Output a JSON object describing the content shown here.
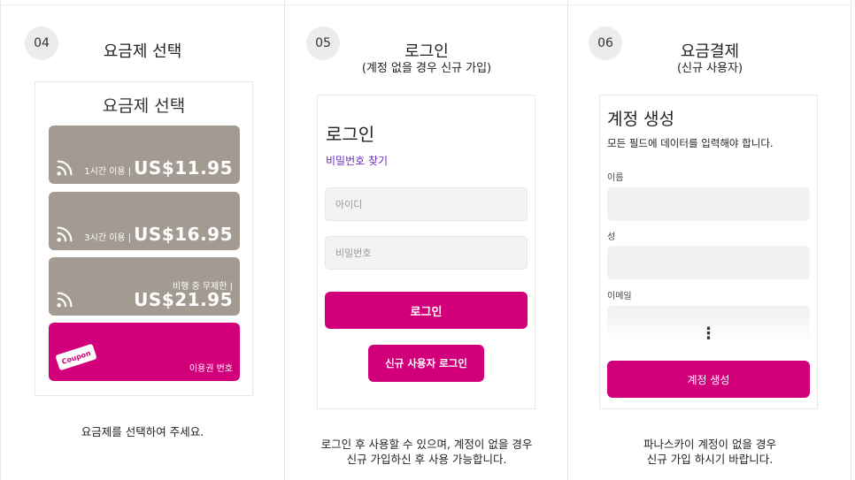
{
  "steps": [
    {
      "number": "04",
      "title": "요금제 선택",
      "caption": "요금제를 선택하여 주세요.",
      "screen": {
        "heading": "요금제 선택",
        "plans": [
          {
            "label": "1시간 이용 |",
            "price": "US$11.95",
            "icon": "wifi-icon"
          },
          {
            "label": "3시간 이용 |",
            "price": "US$16.95",
            "icon": "wifi-icon"
          },
          {
            "label": "비행 중 무제한 |",
            "price": "US$21.95",
            "icon": "wifi-icon"
          }
        ],
        "coupon": {
          "tag": "Coupon",
          "label": "이용권 번호"
        }
      }
    },
    {
      "number": "05",
      "title": "로그인",
      "subtitle": "(계정 없을 경우 신규 가입)",
      "caption_line1": "로그인 후 사용할 수 있으며, 계정이 없을 경우",
      "caption_line2": "신규 가입하신 후 사용 가능합니다.",
      "screen": {
        "heading": "로그인",
        "find_password": "비밀번호 찾기",
        "id_placeholder": "아이디",
        "password_placeholder": "비밀번호",
        "login_button": "로그인",
        "new_user_button": "신규 사용자 로그인"
      }
    },
    {
      "number": "06",
      "title": "요금결제",
      "subtitle": "(신규 사용자)",
      "caption_line1": "파나스카이 계정이 없을 경우",
      "caption_line2": "신규 가입 하시기 바랍니다.",
      "screen": {
        "heading": "계정 생성",
        "description": "모든 필드에 데이터를 입력해야 합니다.",
        "fields": [
          {
            "label": "이름"
          },
          {
            "label": "성"
          },
          {
            "label": "이메일"
          }
        ],
        "more_indicator": "⋮",
        "create_button": "계정 생성"
      }
    }
  ],
  "colors": {
    "accent": "#d1007a",
    "plan_card": "#a39a91",
    "link": "#6a2bc2",
    "badge": "#ececec"
  }
}
